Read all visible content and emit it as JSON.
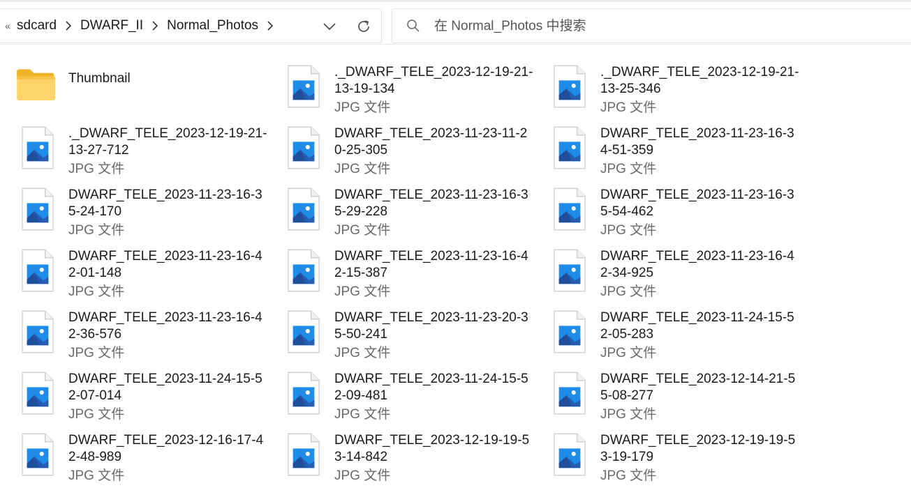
{
  "breadcrumb": {
    "overflow": "«",
    "items": [
      "sdcard",
      "DWARF_II",
      "Normal_Photos"
    ]
  },
  "search": {
    "placeholder": "在 Normal_Photos 中搜索"
  },
  "folders": [
    {
      "name": "Thumbnail"
    }
  ],
  "files": [
    {
      "name": "._DWARF_TELE_2023-12-19-21-\n13-19-134",
      "type": "JPG 文件"
    },
    {
      "name": "._DWARF_TELE_2023-12-19-21-\n13-25-346",
      "type": "JPG 文件"
    },
    {
      "name": "._DWARF_TELE_2023-12-19-21-\n13-27-712",
      "type": "JPG 文件"
    },
    {
      "name": "DWARF_TELE_2023-11-23-11-2\n0-25-305",
      "type": "JPG 文件"
    },
    {
      "name": "DWARF_TELE_2023-11-23-16-3\n4-51-359",
      "type": "JPG 文件"
    },
    {
      "name": "DWARF_TELE_2023-11-23-16-3\n5-24-170",
      "type": "JPG 文件"
    },
    {
      "name": "DWARF_TELE_2023-11-23-16-3\n5-29-228",
      "type": "JPG 文件"
    },
    {
      "name": "DWARF_TELE_2023-11-23-16-3\n5-54-462",
      "type": "JPG 文件"
    },
    {
      "name": "DWARF_TELE_2023-11-23-16-4\n2-01-148",
      "type": "JPG 文件"
    },
    {
      "name": "DWARF_TELE_2023-11-23-16-4\n2-15-387",
      "type": "JPG 文件"
    },
    {
      "name": "DWARF_TELE_2023-11-23-16-4\n2-34-925",
      "type": "JPG 文件"
    },
    {
      "name": "DWARF_TELE_2023-11-23-16-4\n2-36-576",
      "type": "JPG 文件"
    },
    {
      "name": "DWARF_TELE_2023-11-23-20-3\n5-50-241",
      "type": "JPG 文件"
    },
    {
      "name": "DWARF_TELE_2023-11-24-15-5\n2-05-283",
      "type": "JPG 文件"
    },
    {
      "name": "DWARF_TELE_2023-11-24-15-5\n2-07-014",
      "type": "JPG 文件"
    },
    {
      "name": "DWARF_TELE_2023-11-24-15-5\n2-09-481",
      "type": "JPG 文件"
    },
    {
      "name": "DWARF_TELE_2023-12-14-21-5\n5-08-277",
      "type": "JPG 文件"
    },
    {
      "name": "DWARF_TELE_2023-12-16-17-4\n2-48-989",
      "type": "JPG 文件"
    },
    {
      "name": "DWARF_TELE_2023-12-19-19-5\n3-14-842",
      "type": "JPG 文件"
    },
    {
      "name": "DWARF_TELE_2023-12-19-19-5\n3-19-179",
      "type": "JPG 文件"
    }
  ],
  "icons": {
    "folder": "folder-icon",
    "file": "image-file-icon",
    "search": "search-icon",
    "refresh": "refresh-icon",
    "dropdown": "chevron-down-icon",
    "separator": "chevron-right-icon"
  },
  "colors": {
    "folder": "#f5c242",
    "image_blue": "#1f7ad6"
  }
}
